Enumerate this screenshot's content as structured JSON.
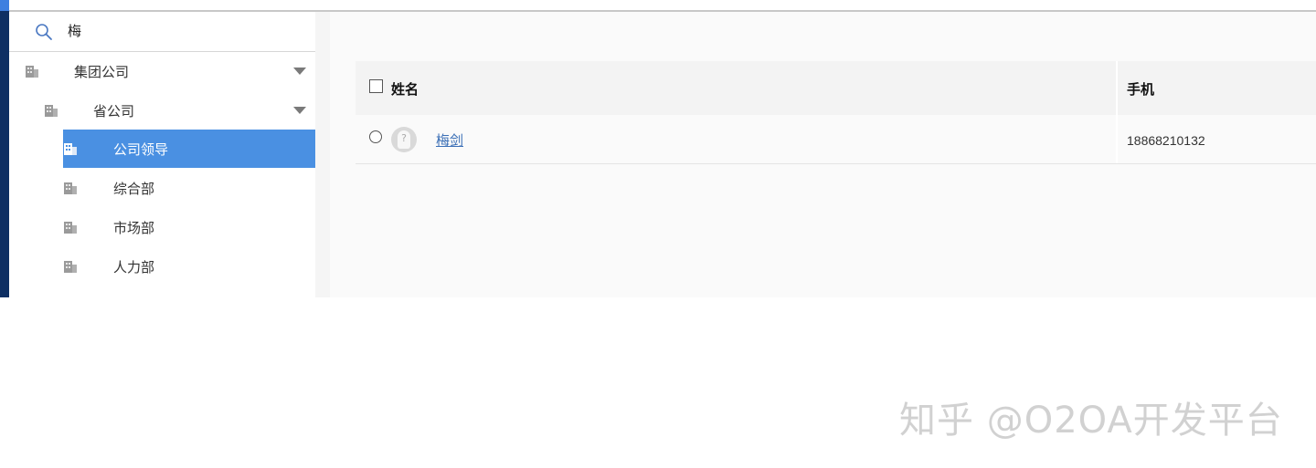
{
  "search": {
    "query": "梅",
    "icon": "search-icon"
  },
  "tree": {
    "items": [
      {
        "label": "集团公司",
        "level": 0,
        "expanded": true,
        "icon": "building-icon"
      },
      {
        "label": "省公司",
        "level": 1,
        "expanded": true,
        "icon": "building-icon"
      },
      {
        "label": "公司领导",
        "level": 2,
        "selected": true,
        "icon": "building-icon"
      },
      {
        "label": "综合部",
        "level": 2,
        "icon": "building-icon"
      },
      {
        "label": "市场部",
        "level": 2,
        "icon": "building-icon"
      },
      {
        "label": "人力部",
        "level": 2,
        "icon": "building-icon"
      }
    ]
  },
  "table": {
    "headers": {
      "name": "姓名",
      "phone": "手机"
    },
    "rows": [
      {
        "name": "梅剑",
        "phone": "18868210132",
        "avatar": "avatar-placeholder-icon"
      }
    ]
  },
  "watermark": "知乎 @O2OA开发平台",
  "colors": {
    "accent": "#4a90e2",
    "sidebar_dark": "#0e2f63",
    "link": "#3b6fb6"
  }
}
